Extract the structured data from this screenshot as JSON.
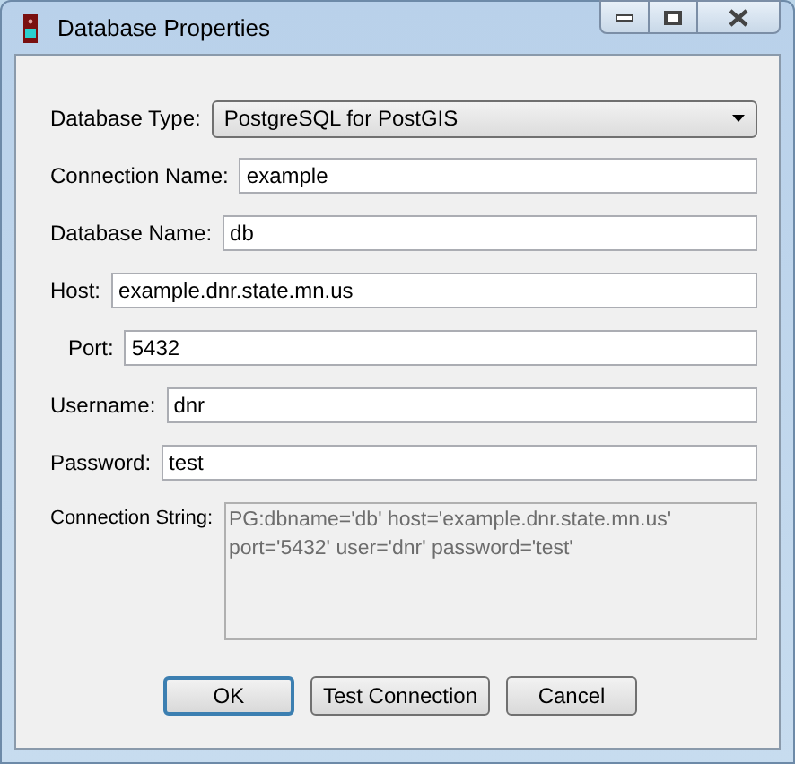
{
  "window": {
    "title": "Database Properties"
  },
  "fields": [
    {
      "kind": "select",
      "label": "Database Type:",
      "value": "PostgreSQL for PostGIS"
    },
    {
      "kind": "text",
      "label": "Connection Name:",
      "value": "example"
    },
    {
      "kind": "text",
      "label": "Database Name:",
      "value": "db"
    },
    {
      "kind": "text",
      "label": "Host:",
      "value": "example.dnr.state.mn.us"
    },
    {
      "kind": "indented",
      "label": "Port:",
      "value": "5432"
    },
    {
      "kind": "text",
      "label": "Username:",
      "value": "dnr"
    },
    {
      "kind": "text",
      "label": "Password:",
      "value": "test"
    }
  ],
  "connection_string": {
    "label": "Connection String:",
    "value": "PG:dbname='db' host='example.dnr.state.mn.us' port='5432' user='dnr' password='test'"
  },
  "buttons": [
    {
      "label": "OK",
      "default": true
    },
    {
      "label": "Test Connection",
      "default": false
    },
    {
      "label": "Cancel",
      "default": false
    }
  ]
}
